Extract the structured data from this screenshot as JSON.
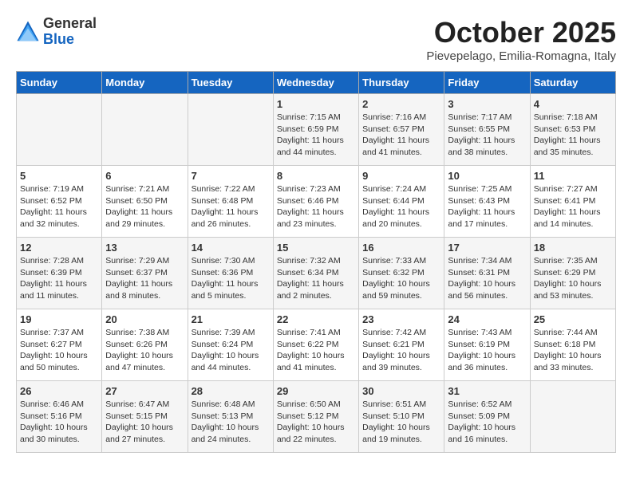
{
  "header": {
    "logo_general": "General",
    "logo_blue": "Blue",
    "month": "October 2025",
    "location": "Pievepelago, Emilia-Romagna, Italy"
  },
  "days_of_week": [
    "Sunday",
    "Monday",
    "Tuesday",
    "Wednesday",
    "Thursday",
    "Friday",
    "Saturday"
  ],
  "weeks": [
    [
      {
        "day": "",
        "content": ""
      },
      {
        "day": "",
        "content": ""
      },
      {
        "day": "",
        "content": ""
      },
      {
        "day": "1",
        "content": "Sunrise: 7:15 AM\nSunset: 6:59 PM\nDaylight: 11 hours\nand 44 minutes."
      },
      {
        "day": "2",
        "content": "Sunrise: 7:16 AM\nSunset: 6:57 PM\nDaylight: 11 hours\nand 41 minutes."
      },
      {
        "day": "3",
        "content": "Sunrise: 7:17 AM\nSunset: 6:55 PM\nDaylight: 11 hours\nand 38 minutes."
      },
      {
        "day": "4",
        "content": "Sunrise: 7:18 AM\nSunset: 6:53 PM\nDaylight: 11 hours\nand 35 minutes."
      }
    ],
    [
      {
        "day": "5",
        "content": "Sunrise: 7:19 AM\nSunset: 6:52 PM\nDaylight: 11 hours\nand 32 minutes."
      },
      {
        "day": "6",
        "content": "Sunrise: 7:21 AM\nSunset: 6:50 PM\nDaylight: 11 hours\nand 29 minutes."
      },
      {
        "day": "7",
        "content": "Sunrise: 7:22 AM\nSunset: 6:48 PM\nDaylight: 11 hours\nand 26 minutes."
      },
      {
        "day": "8",
        "content": "Sunrise: 7:23 AM\nSunset: 6:46 PM\nDaylight: 11 hours\nand 23 minutes."
      },
      {
        "day": "9",
        "content": "Sunrise: 7:24 AM\nSunset: 6:44 PM\nDaylight: 11 hours\nand 20 minutes."
      },
      {
        "day": "10",
        "content": "Sunrise: 7:25 AM\nSunset: 6:43 PM\nDaylight: 11 hours\nand 17 minutes."
      },
      {
        "day": "11",
        "content": "Sunrise: 7:27 AM\nSunset: 6:41 PM\nDaylight: 11 hours\nand 14 minutes."
      }
    ],
    [
      {
        "day": "12",
        "content": "Sunrise: 7:28 AM\nSunset: 6:39 PM\nDaylight: 11 hours\nand 11 minutes."
      },
      {
        "day": "13",
        "content": "Sunrise: 7:29 AM\nSunset: 6:37 PM\nDaylight: 11 hours\nand 8 minutes."
      },
      {
        "day": "14",
        "content": "Sunrise: 7:30 AM\nSunset: 6:36 PM\nDaylight: 11 hours\nand 5 minutes."
      },
      {
        "day": "15",
        "content": "Sunrise: 7:32 AM\nSunset: 6:34 PM\nDaylight: 11 hours\nand 2 minutes."
      },
      {
        "day": "16",
        "content": "Sunrise: 7:33 AM\nSunset: 6:32 PM\nDaylight: 10 hours\nand 59 minutes."
      },
      {
        "day": "17",
        "content": "Sunrise: 7:34 AM\nSunset: 6:31 PM\nDaylight: 10 hours\nand 56 minutes."
      },
      {
        "day": "18",
        "content": "Sunrise: 7:35 AM\nSunset: 6:29 PM\nDaylight: 10 hours\nand 53 minutes."
      }
    ],
    [
      {
        "day": "19",
        "content": "Sunrise: 7:37 AM\nSunset: 6:27 PM\nDaylight: 10 hours\nand 50 minutes."
      },
      {
        "day": "20",
        "content": "Sunrise: 7:38 AM\nSunset: 6:26 PM\nDaylight: 10 hours\nand 47 minutes."
      },
      {
        "day": "21",
        "content": "Sunrise: 7:39 AM\nSunset: 6:24 PM\nDaylight: 10 hours\nand 44 minutes."
      },
      {
        "day": "22",
        "content": "Sunrise: 7:41 AM\nSunset: 6:22 PM\nDaylight: 10 hours\nand 41 minutes."
      },
      {
        "day": "23",
        "content": "Sunrise: 7:42 AM\nSunset: 6:21 PM\nDaylight: 10 hours\nand 39 minutes."
      },
      {
        "day": "24",
        "content": "Sunrise: 7:43 AM\nSunset: 6:19 PM\nDaylight: 10 hours\nand 36 minutes."
      },
      {
        "day": "25",
        "content": "Sunrise: 7:44 AM\nSunset: 6:18 PM\nDaylight: 10 hours\nand 33 minutes."
      }
    ],
    [
      {
        "day": "26",
        "content": "Sunrise: 6:46 AM\nSunset: 5:16 PM\nDaylight: 10 hours\nand 30 minutes."
      },
      {
        "day": "27",
        "content": "Sunrise: 6:47 AM\nSunset: 5:15 PM\nDaylight: 10 hours\nand 27 minutes."
      },
      {
        "day": "28",
        "content": "Sunrise: 6:48 AM\nSunset: 5:13 PM\nDaylight: 10 hours\nand 24 minutes."
      },
      {
        "day": "29",
        "content": "Sunrise: 6:50 AM\nSunset: 5:12 PM\nDaylight: 10 hours\nand 22 minutes."
      },
      {
        "day": "30",
        "content": "Sunrise: 6:51 AM\nSunset: 5:10 PM\nDaylight: 10 hours\nand 19 minutes."
      },
      {
        "day": "31",
        "content": "Sunrise: 6:52 AM\nSunset: 5:09 PM\nDaylight: 10 hours\nand 16 minutes."
      },
      {
        "day": "",
        "content": ""
      }
    ]
  ]
}
